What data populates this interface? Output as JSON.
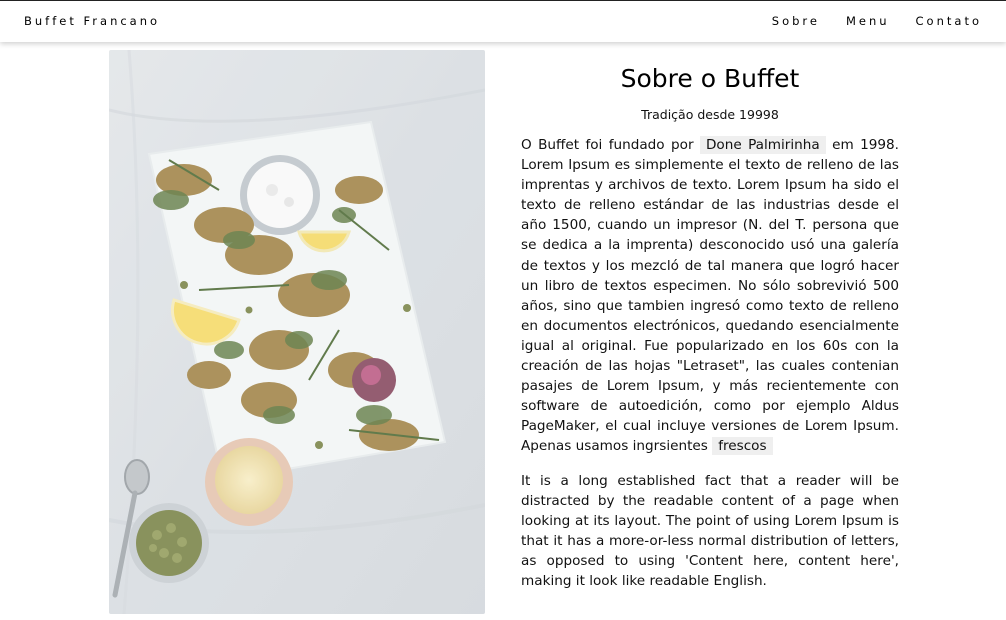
{
  "nav": {
    "brand": "Buffet Francano",
    "links": [
      "Sobre",
      "Menu",
      "Contato"
    ]
  },
  "about": {
    "title": "Sobre o Buffet",
    "subtitle": "Tradição desde 19998",
    "p1_before": "O Buffet foi fundado por",
    "p1_highlight": "Done Palmirinha",
    "p1_middle": "em 1998. Lorem Ipsum es simplemente el texto de relleno de las imprentas y archivos de texto. Lorem Ipsum ha sido el texto de relleno estándar de las industrias desde el año 1500, cuando un impresor (N. del T. persona que se dedica a la imprenta) desconocido usó una galería de textos y los mezcló de tal manera que logró hacer un libro de textos especimen. No sólo sobrevivió 500 años, sino que tambien ingresó como texto de relleno en documentos electrónicos, quedando esencialmente igual al original. Fue popularizado en los 60s con la creación de las hojas \"Letraset\", las cuales contenian pasajes de Lorem Ipsum, y más recientemente con software de autoedición, como por ejemplo Aldus PageMaker, el cual incluye versiones de Lorem Ipsum. Apenas usamos ingrsientes",
    "p1_highlight2": "frescos",
    "p2": "It is a long established fact that a reader will be distracted by the readable content of a page when looking at its layout. The point of using Lorem Ipsum is that it has a more-or-less normal distribution of letters, as opposed to using 'Content here, content here', making it look like readable English."
  },
  "colors": {
    "background": "#ffffff",
    "tag": "#efefef",
    "tablecloth": "#d9dee2",
    "board": "#f1f4f5"
  }
}
